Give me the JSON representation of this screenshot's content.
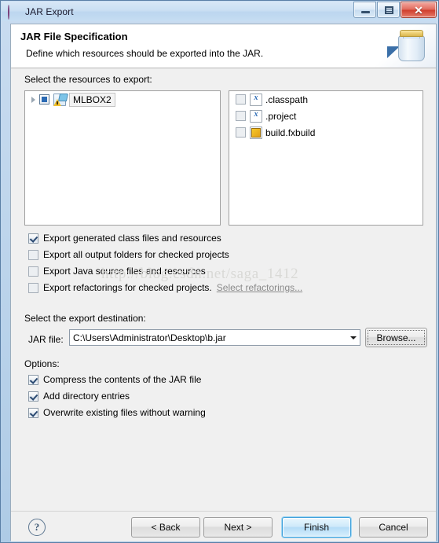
{
  "window": {
    "title": "JAR Export",
    "icon": "jar-sphere-icon",
    "controls": {
      "minimize": "minimize-icon",
      "maximize": "maximize-icon",
      "close": "✕"
    }
  },
  "header": {
    "title": "JAR File Specification",
    "subtitle": "Define which resources should be exported into the JAR.",
    "graphic": "jar-with-blue-arrow-icon"
  },
  "resources": {
    "label": "Select the resources to export:",
    "tree": [
      {
        "label": "MLBOX2",
        "checkbox_state": "partial",
        "expandable": true,
        "selected": true,
        "icon": "java-project-warning-icon"
      }
    ],
    "files": [
      {
        "label": ".classpath",
        "checked": false,
        "icon": "xml-file-icon"
      },
      {
        "label": ".project",
        "checked": false,
        "icon": "xml-file-icon"
      },
      {
        "label": "build.fxbuild",
        "checked": false,
        "icon": "fxbuild-file-icon"
      }
    ]
  },
  "export_options": [
    {
      "label": "Export generated class files and resources",
      "checked": true,
      "disabled": false
    },
    {
      "label": "Export all output folders for checked projects",
      "checked": false,
      "disabled": false
    },
    {
      "label": "Export Java source files and resources",
      "checked": false,
      "disabled": false
    },
    {
      "label": "Export refactorings for checked projects.",
      "checked": false,
      "disabled": false,
      "link": "Select refactorings..."
    }
  ],
  "destination": {
    "label": "Select the export destination:",
    "field_label": "JAR file:",
    "value": "C:\\Users\\Administrator\\Desktop\\b.jar",
    "browse_label": "Browse..."
  },
  "options": {
    "label": "Options:",
    "items": [
      {
        "label": "Compress the contents of the JAR file",
        "checked": true
      },
      {
        "label": "Add directory entries",
        "checked": true
      },
      {
        "label": "Overwrite existing files without warning",
        "checked": true
      }
    ]
  },
  "footer": {
    "help": "?",
    "back": "< Back",
    "next": "Next >",
    "finish": "Finish",
    "cancel": "Cancel"
  },
  "watermark": "http://blog.csdn.net/saga_1412",
  "colors": {
    "accent": "#3c9fdb",
    "titlebar": "#cadff3",
    "dialog_bg": "#f0f0f0",
    "close_red": "#cf3d2c"
  }
}
